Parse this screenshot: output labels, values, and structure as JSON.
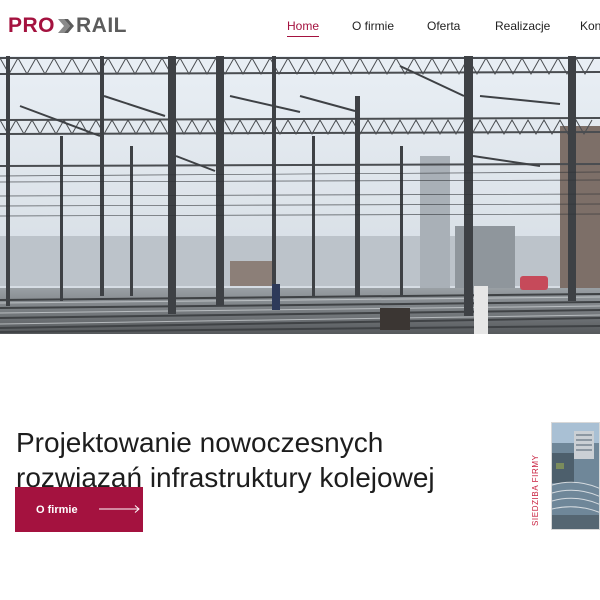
{
  "brand": {
    "logo_left": "PRO",
    "logo_right": "RAIL",
    "primary_color": "#a4123f",
    "secondary_color": "#5c5c5c"
  },
  "nav": {
    "items": [
      {
        "label": "Home",
        "active": true
      },
      {
        "label": "O firmie",
        "active": false
      },
      {
        "label": "Oferta",
        "active": false
      },
      {
        "label": "Realizacje",
        "active": false
      },
      {
        "label": "Kon",
        "active": false
      }
    ]
  },
  "hero": {
    "image": "railway-yard-photo"
  },
  "main": {
    "headline_line1": "Projektowanie nowoczesnych",
    "headline_line2": "rozwiązań infrastruktury kolejowej",
    "cta_label": "O firmie",
    "cta_icon": "arrow-right-icon"
  },
  "side": {
    "label": "SIEDZIBA FIRMY",
    "image": "headquarters-aerial-photo"
  }
}
